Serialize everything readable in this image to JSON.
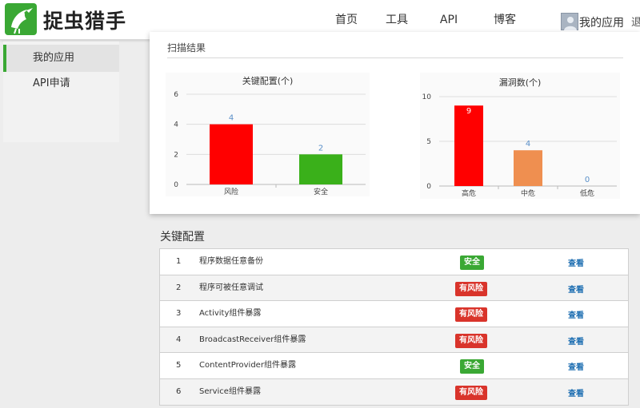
{
  "header": {
    "logo_text": "捉虫猎手",
    "nav": [
      {
        "label": "首页",
        "active": false
      },
      {
        "label": "工具",
        "active": false
      },
      {
        "label": "API",
        "active": true
      },
      {
        "label": "博客",
        "active": false
      }
    ],
    "user_label": "我的应用",
    "logout_label": "退"
  },
  "sidebar": {
    "items": [
      {
        "label": "我的应用",
        "active": true
      },
      {
        "label": "API申请",
        "active": false
      }
    ]
  },
  "scan": {
    "title": "扫描结果"
  },
  "chart_data": [
    {
      "type": "bar",
      "title": "关键配置(个)",
      "categories": [
        "风险",
        "安全"
      ],
      "values": [
        4,
        2
      ],
      "colors": [
        "#ff0000",
        "#3ab01a"
      ],
      "ylim": [
        0,
        6
      ],
      "yticks": [
        0,
        2,
        4,
        6
      ],
      "grid": true
    },
    {
      "type": "bar",
      "title": "漏洞数(个)",
      "categories": [
        "高危",
        "中危",
        "低危"
      ],
      "values": [
        9,
        4,
        0
      ],
      "colors": [
        "#ff0000",
        "#ef8f50",
        "#cccccc"
      ],
      "ylim": [
        0,
        10
      ],
      "yticks": [
        0,
        5,
        10
      ],
      "grid": true
    }
  ],
  "config_section": {
    "title": "关键配置",
    "rows": [
      {
        "num": "1",
        "name": "程序数据任意备份",
        "status": "安全",
        "level": "safe",
        "action": "查看"
      },
      {
        "num": "2",
        "name": "程序可被任意调试",
        "status": "有风险",
        "level": "risk",
        "action": "查看"
      },
      {
        "num": "3",
        "name": "Activity组件暴露",
        "status": "有风险",
        "level": "risk",
        "action": "查看"
      },
      {
        "num": "4",
        "name": "BroadcastReceiver组件暴露",
        "status": "有风险",
        "level": "risk",
        "action": "查看"
      },
      {
        "num": "5",
        "name": "ContentProvider组件暴露",
        "status": "安全",
        "level": "safe",
        "action": "查看"
      },
      {
        "num": "6",
        "name": "Service组件暴露",
        "status": "有风险",
        "level": "risk",
        "action": "查看"
      }
    ]
  },
  "colors": {
    "accent": "#3aa834",
    "risk": "#d9342b",
    "link": "#1f6fb2"
  }
}
